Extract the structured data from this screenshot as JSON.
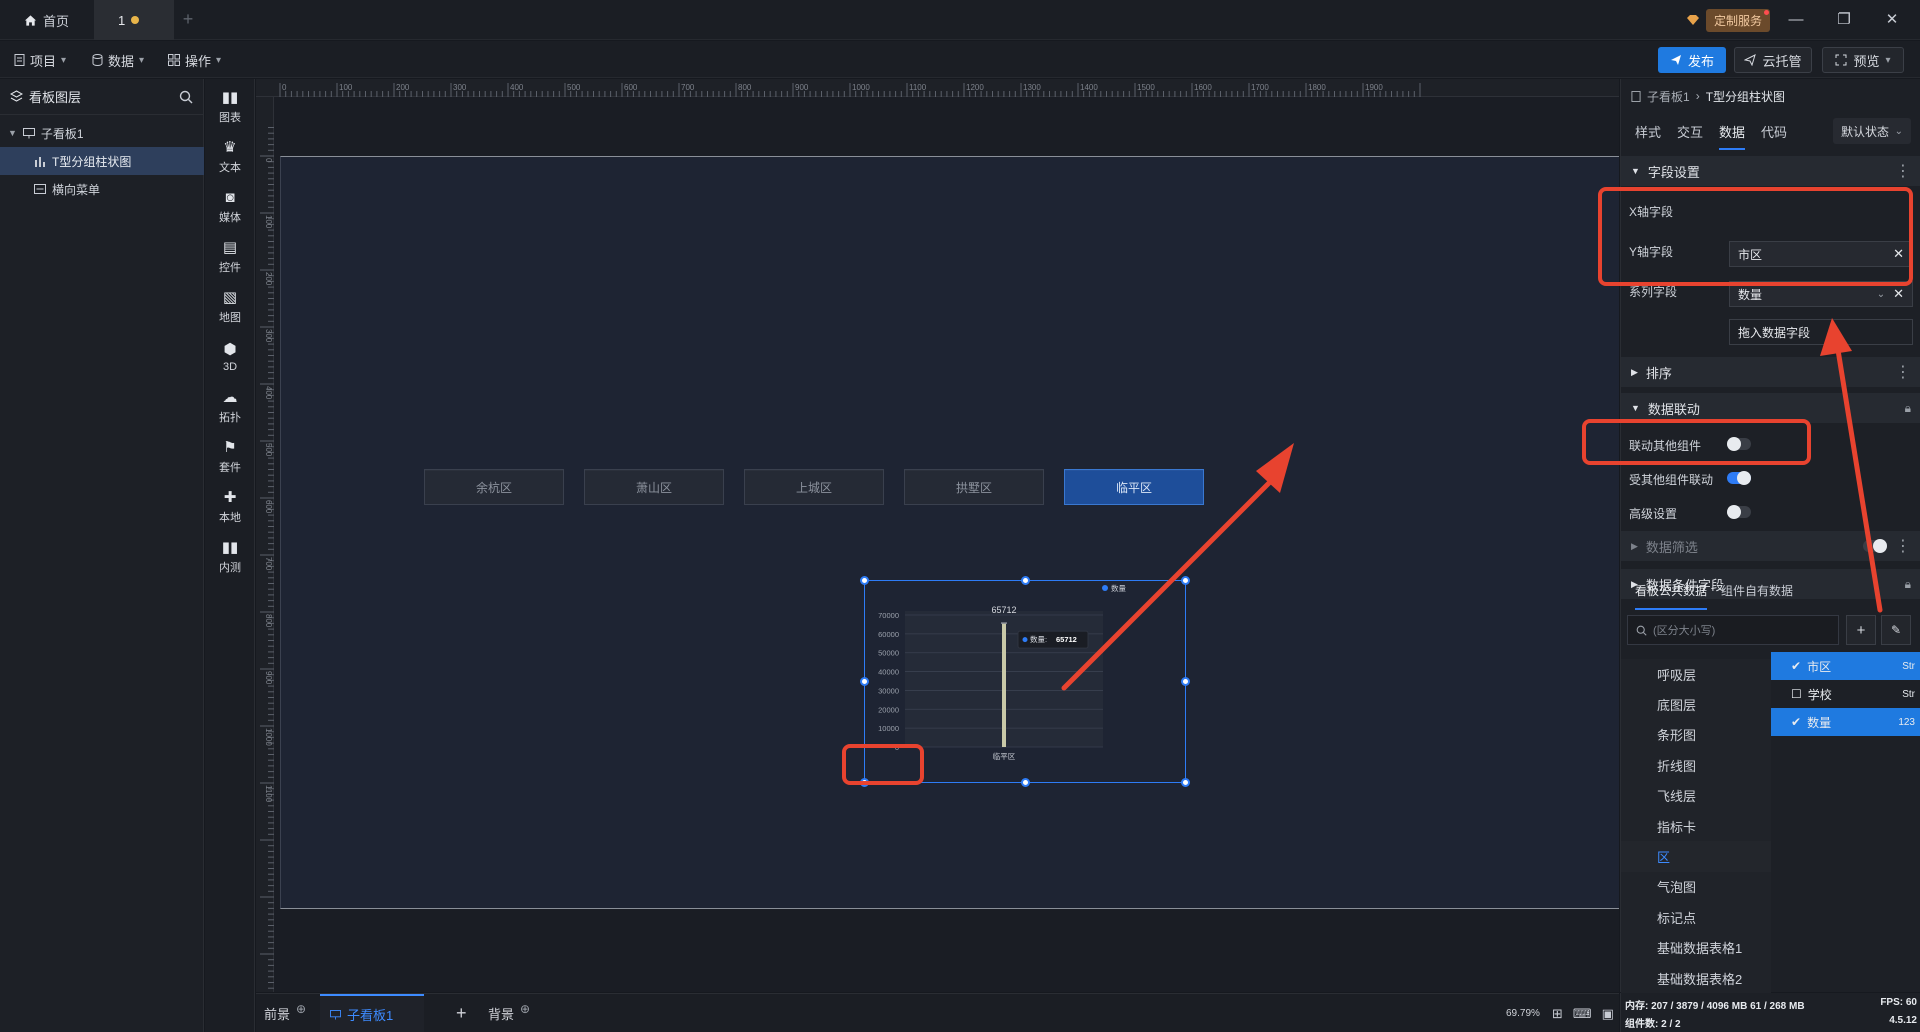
{
  "titlebar": {
    "home_tab": "首页",
    "doc_tab": "1",
    "custom_service": "定制服务"
  },
  "menubar": {
    "project": "项目",
    "data": "数据",
    "operation": "操作",
    "publish": "发布",
    "cloud_hosting": "云托管",
    "preview": "预览"
  },
  "layers": {
    "title": "看板图层",
    "items": [
      {
        "label": "子看板1"
      },
      {
        "label": "T型分组柱状图"
      },
      {
        "label": "横向菜单"
      }
    ]
  },
  "tools": [
    {
      "label": "图表",
      "icon": "bar-chart-icon"
    },
    {
      "label": "文本",
      "icon": "text-icon"
    },
    {
      "label": "媒体",
      "icon": "media-icon"
    },
    {
      "label": "控件",
      "icon": "control-icon"
    },
    {
      "label": "地图",
      "icon": "map-icon"
    },
    {
      "label": "3D",
      "icon": "cube-icon"
    },
    {
      "label": "拓扑",
      "icon": "topology-icon"
    },
    {
      "label": "套件",
      "icon": "kit-icon"
    },
    {
      "label": "本地",
      "icon": "puzzle-icon"
    },
    {
      "label": "内测",
      "icon": "beta-icon"
    }
  ],
  "canvas": {
    "ruler_h": [
      "0",
      "100",
      "200",
      "300",
      "400",
      "500",
      "600",
      "700",
      "800",
      "900",
      "1000",
      "1100",
      "1200",
      "1300",
      "1400",
      "1500",
      "1600",
      "1700",
      "1800",
      "1900"
    ],
    "ruler_v": [
      "0",
      "100",
      "200",
      "300",
      "400",
      "500",
      "600",
      "700",
      "800",
      "900",
      "1000",
      "1100"
    ],
    "district_buttons": [
      {
        "label": "余杭区",
        "active": false
      },
      {
        "label": "萧山区",
        "active": false
      },
      {
        "label": "上城区",
        "active": false
      },
      {
        "label": "拱墅区",
        "active": false
      },
      {
        "label": "临平区",
        "active": true
      }
    ]
  },
  "chart_data": {
    "type": "bar",
    "categories": [
      "临平区"
    ],
    "series": [
      {
        "name": "数量",
        "values": [
          65712
        ]
      }
    ],
    "ylim": [
      0,
      70000
    ],
    "yticks": [
      "70000",
      "60000",
      "50000",
      "40000",
      "30000",
      "20000",
      "10000",
      "0"
    ],
    "data_label": "65712",
    "tooltip": {
      "label": "数量:",
      "value": "65712"
    },
    "legend": "top-right",
    "grid": true,
    "bar_color": "#c9c9a8"
  },
  "bottombar": {
    "foreground": "前景",
    "sub_board": "子看板1",
    "background": "背景",
    "zoom": "69.79%"
  },
  "props": {
    "breadcrumb_root": "子看板1",
    "breadcrumb_leaf": "T型分组柱状图",
    "tabs": [
      "样式",
      "交互",
      "数据",
      "代码"
    ],
    "state_select": "默认状态",
    "field_settings": "字段设置",
    "x_label": "X轴字段",
    "x_value": "市区",
    "y_label": "Y轴字段",
    "y_value": "数量",
    "series_label": "系列字段",
    "series_placeholder": "拖入数据字段",
    "sort": "排序",
    "data_linkage": "数据联动",
    "link_other": "联动其他组件",
    "linked_by_other": "受其他组件联动",
    "advanced": "高级设置",
    "data_filter": "数据筛选",
    "data_condition": "数据条件字段",
    "subtab_public": "看板公共数据",
    "subtab_own": "组件自有数据",
    "search_placeholder": "(区分大小写)",
    "components": [
      "呼吸层",
      "底图层",
      "条形图",
      "折线图",
      "飞线层",
      "指标卡",
      "区",
      "气泡图",
      "标记点",
      "基础数据表格1",
      "基础数据表格2"
    ],
    "fields": [
      {
        "label": "市区",
        "type": "Str",
        "checked": true
      },
      {
        "label": "学校",
        "type": "Str",
        "checked": false
      },
      {
        "label": "数量",
        "type": "123",
        "checked": true
      }
    ],
    "status_memory": "内存: 207 / 3879 / 4096 MB  61 / 268 MB",
    "status_fps": "FPS: 60",
    "status_components": "组件数: 2 / 2",
    "status_version": "4.5.12"
  },
  "colors": {
    "accent": "#1f7ae0",
    "annotation": "#e8432f",
    "artboard": "#1e2433"
  }
}
